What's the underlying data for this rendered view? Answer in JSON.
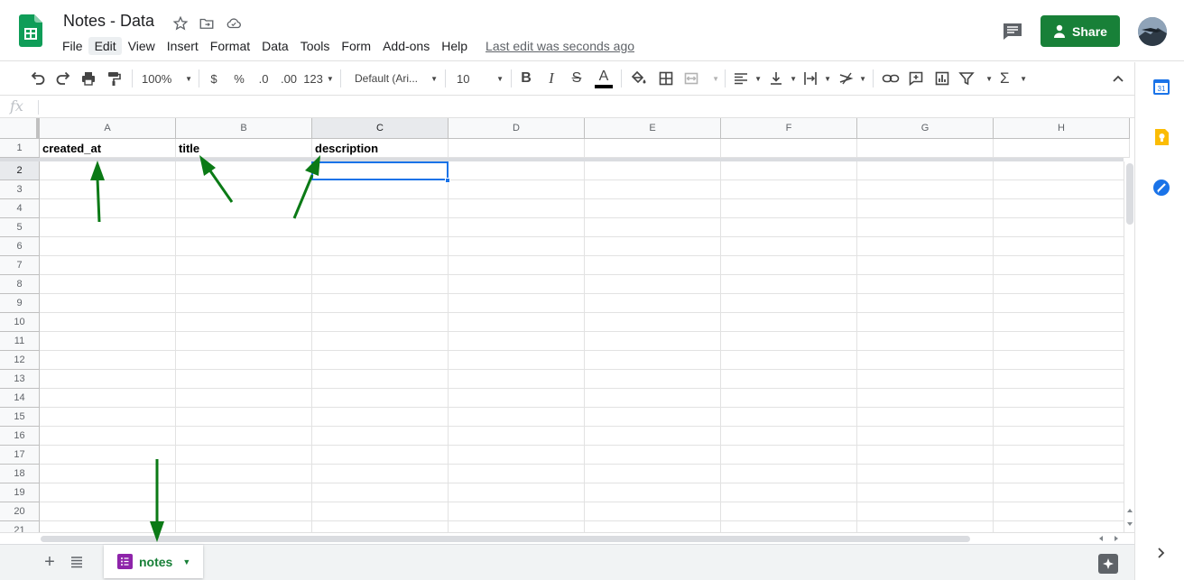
{
  "app": {
    "title": "Notes - Data",
    "share_label": "Share",
    "last_edit": "Last edit was seconds ago"
  },
  "menu": {
    "items": [
      "File",
      "Edit",
      "View",
      "Insert",
      "Format",
      "Data",
      "Tools",
      "Form",
      "Add-ons",
      "Help"
    ],
    "active": "Edit"
  },
  "toolbar": {
    "zoom": "100%",
    "currency": "$",
    "percent": "%",
    "decrease_decimal": ".0",
    "increase_decimal": ".00",
    "more_formats": "123",
    "font": "Default (Ari...",
    "font_size": "10",
    "bold": "B",
    "italic": "I",
    "strikethrough": "S",
    "text_color": "A",
    "sum": "Σ"
  },
  "formula_bar": {
    "fx_label": "fx",
    "value": ""
  },
  "grid": {
    "columns": [
      "A",
      "B",
      "C",
      "D",
      "E",
      "F",
      "G",
      "H"
    ],
    "selected_column": "C",
    "rows": [
      "1",
      "2",
      "3",
      "4",
      "5",
      "6",
      "7",
      "8",
      "9",
      "10",
      "11",
      "12",
      "13",
      "14",
      "15",
      "16",
      "17",
      "18",
      "19",
      "20",
      "21"
    ],
    "selected_row": "2",
    "header_row": [
      "created_at",
      "title",
      "description",
      "",
      "",
      "",
      "",
      ""
    ]
  },
  "sheets": {
    "tabs": [
      {
        "name": "notes",
        "active": true
      }
    ],
    "add_label": "+"
  },
  "colors": {
    "brand_green": "#188038",
    "selection_blue": "#1a73e8",
    "annotation_arrow": "#0b7a16",
    "tab_icon": "#8e24aa"
  },
  "icons": [
    "sheets-logo",
    "star-icon",
    "move-folder-icon",
    "cloud-icon",
    "comment-icon",
    "person-icon",
    "undo-icon",
    "redo-icon",
    "print-icon",
    "paint-format-icon",
    "fill-color-icon",
    "borders-icon",
    "merge-icon",
    "align-icon",
    "valign-icon",
    "wrap-icon",
    "rotate-icon",
    "link-icon",
    "comment-add-icon",
    "chart-icon",
    "filter-icon",
    "collapse-icon",
    "calendar-icon",
    "keep-icon",
    "tasks-icon",
    "explore-icon"
  ]
}
